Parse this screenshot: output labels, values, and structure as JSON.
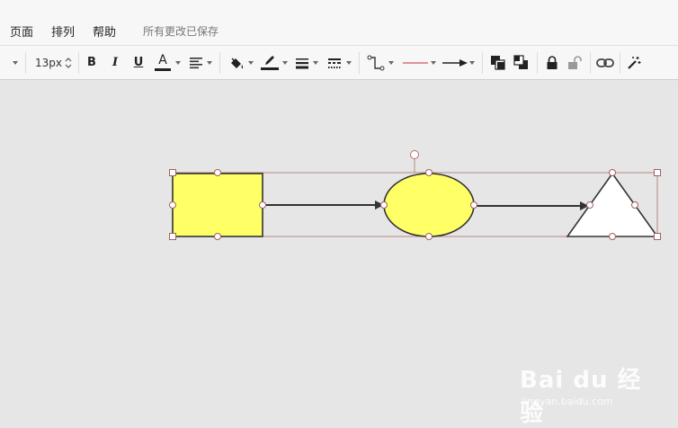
{
  "menubar": {
    "items": [
      "页面",
      "排列",
      "帮助"
    ],
    "status": "所有更改已保存"
  },
  "toolbar": {
    "font_size": "13px",
    "bold": "B",
    "italic": "I",
    "underline": "U",
    "font_color": "A",
    "buttons": [
      "dropdown-menu",
      "font-size-stepper",
      "bold",
      "italic",
      "underline",
      "font-color",
      "text-align",
      "fill-color",
      "line-color",
      "line-width",
      "line-style",
      "connector-type",
      "line-type",
      "arrow-style",
      "bring-to-front",
      "send-to-back",
      "lock",
      "unlock",
      "link",
      "magic-format"
    ]
  },
  "shapes": [
    {
      "type": "rectangle",
      "fill": "#ffff66"
    },
    {
      "type": "ellipse",
      "fill": "#ffff66"
    },
    {
      "type": "triangle",
      "fill": "#ffffff"
    }
  ],
  "colors": {
    "selection": "#b07070",
    "shape_stroke": "#333333",
    "canvas": "#e6e6e6"
  },
  "watermark": {
    "main": "Bai du 经验",
    "sub": "jingyan.baidu.com"
  }
}
